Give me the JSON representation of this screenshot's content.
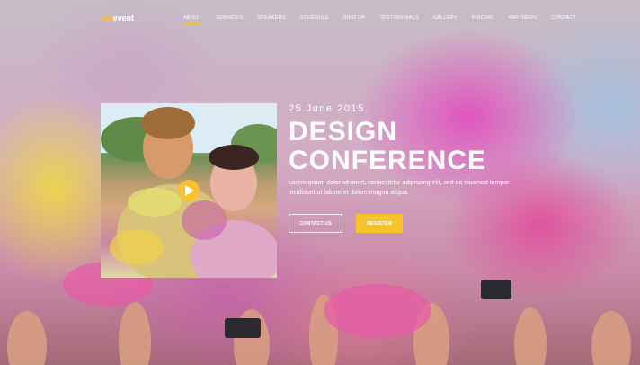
{
  "logo": {
    "accent": "mo",
    "text": "event"
  },
  "nav": {
    "items": [
      {
        "label": "ABOUT",
        "active": true
      },
      {
        "label": "SERVICES"
      },
      {
        "label": "SPEAKERS"
      },
      {
        "label": "SCHEDULE"
      },
      {
        "label": "SING UP"
      },
      {
        "label": "TESTIMONIALS"
      },
      {
        "label": "GALLERY"
      },
      {
        "label": "PRICING"
      },
      {
        "label": "PARTNERS"
      },
      {
        "label": "CONTACT"
      }
    ]
  },
  "hero": {
    "date": "25 June 2015",
    "title_line1": "DESIGN",
    "title_line2": "CONFERENCE",
    "description": "Lorem ipsum dolor sit amet, consectetur adipiscing elit, sed do eiusmod tempor incididunt ut labore et dolore magna aliqua.",
    "contact_button": "CONTACT US",
    "register_button": "REGISTER",
    "play_icon": "play-icon"
  },
  "colors": {
    "accent": "#f7c22c",
    "text": "#ffffff"
  }
}
